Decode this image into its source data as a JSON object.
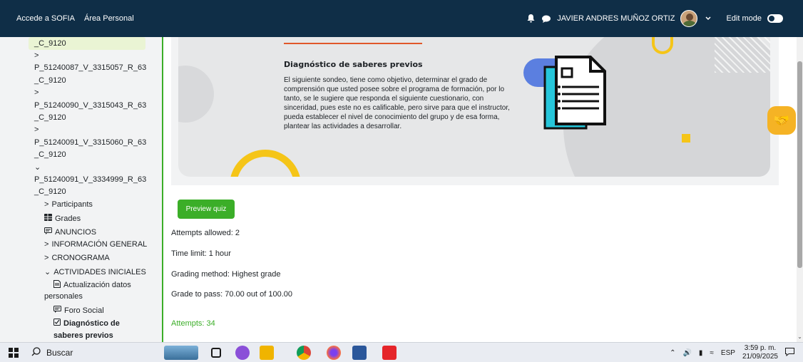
{
  "navbar": {
    "brand": "Accede a SOFIA",
    "home": "Área Personal",
    "user_name": "JAVIER ANDRES MUÑOZ ORTIZ",
    "edit_mode_label": "Edit mode"
  },
  "sidebar": {
    "code_lines": [
      "_C_9120",
      "P_51240087_V_3315057_R_63",
      "_C_9120",
      "P_51240090_V_3315043_R_63",
      "_C_9120",
      "P_51240091_V_3315060_R_63",
      "_C_9120",
      "P_51240091_V_3334999_R_63",
      "_C_9120"
    ],
    "participants": "Participants",
    "grades": "Grades",
    "anuncios": "ANUNCIOS",
    "info_general": "INFORMACIÓN GENERAL",
    "cronograma": "CRONOGRAMA",
    "actividades": "ACTIVIDADES INICIALES",
    "actualizacion_1": "Actualización datos",
    "actualizacion_2": "personales",
    "foro": "Foro Social",
    "diagnostico_1": "Diagnóstico de",
    "diagnostico_2": "saberes previos"
  },
  "banner": {
    "title": "Diagnóstico de saberes previos",
    "text": "El siguiente sondeo, tiene como objetivo, determinar el grado de comprensión que usted posee sobre el programa de formación, por lo tanto, se le sugiere que responda el siguiente cuestionario, con sinceridad, pues este no es calificable, pero sirve para que el instructor, pueda establecer el nivel de conocimiento del grupo y de esa forma, plantear las actividades a desarrollar."
  },
  "quiz": {
    "preview_button": "Preview quiz",
    "attempts_allowed": "Attempts allowed: 2",
    "time_limit": "Time limit: 1 hour",
    "grading_method": "Grading method: Highest grade",
    "grade_to_pass": "Grade to pass: 70.00 out of 100.00",
    "attempts": "Attempts: 34"
  },
  "taskbar": {
    "search_label": "Buscar",
    "lang": "ESP",
    "time": "3:59 p. m.",
    "date": "21/09/2025"
  },
  "colors": {
    "navbar": "#0f2e47",
    "accent_green": "#3bae28",
    "banner_yellow": "#f5c518",
    "banner_orange": "#e0582a"
  }
}
